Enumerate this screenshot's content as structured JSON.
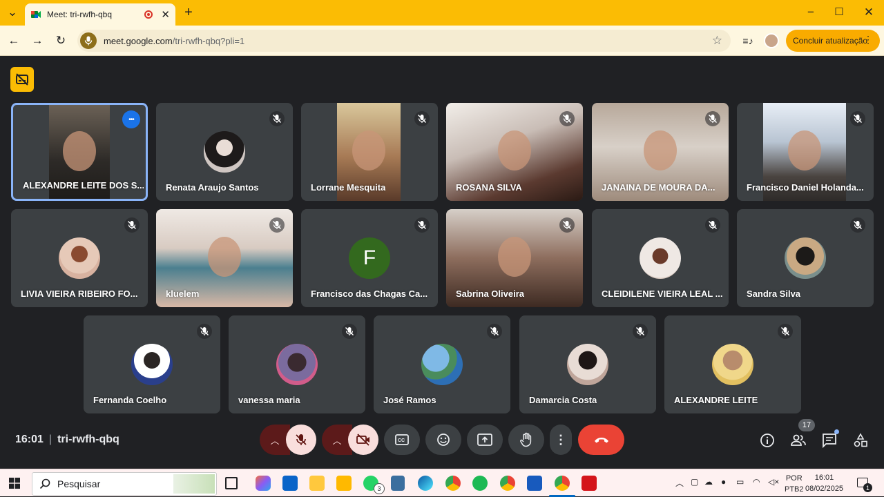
{
  "browser": {
    "tab_title": "Meet: tri-rwfh-qbq",
    "url_host": "meet.google.com",
    "url_path": "/tri-rwfh-qbq?pli=1",
    "update_button": "Concluir atualização",
    "accent": "#fbbc04"
  },
  "participants": [
    {
      "name": "ALEXANDRE LEITE DOS S...",
      "type": "video"
    },
    {
      "name": "Renata Araujo Santos",
      "type": "avatar"
    },
    {
      "name": "Lorrane Mesquita",
      "type": "video"
    },
    {
      "name": "ROSANA SILVA",
      "type": "video"
    },
    {
      "name": "JANAINA DE MOURA DA...",
      "type": "video"
    },
    {
      "name": "Francisco Daniel Holanda...",
      "type": "video"
    },
    {
      "name": "LIVIA VIEIRA RIBEIRO FO...",
      "type": "avatar"
    },
    {
      "name": "kluelem",
      "type": "video"
    },
    {
      "name": "Francisco das Chagas Ca...",
      "type": "letter",
      "letter": "F"
    },
    {
      "name": "Sabrina Oliveira",
      "type": "video"
    },
    {
      "name": "CLEIDILENE VIEIRA LEAL ...",
      "type": "avatar"
    },
    {
      "name": "Sandra Silva",
      "type": "avatar"
    },
    {
      "name": "Fernanda Coelho",
      "type": "avatar"
    },
    {
      "name": "vanessa maria",
      "type": "avatar"
    },
    {
      "name": "José Ramos",
      "type": "avatar"
    },
    {
      "name": "Damarcia Costa",
      "type": "avatar"
    },
    {
      "name": "ALEXANDRE LEITE",
      "type": "avatar"
    }
  ],
  "meeting": {
    "time": "16:01",
    "code": "tri-rwfh-qbq",
    "participant_count": "17"
  },
  "taskbar": {
    "search_label": "Pesquisar",
    "lang_line1": "POR",
    "lang_line2": "PTB2",
    "clock_time": "16:01",
    "clock_date": "08/02/2025",
    "whatsapp_badge": "3",
    "notif_badge": "1"
  }
}
